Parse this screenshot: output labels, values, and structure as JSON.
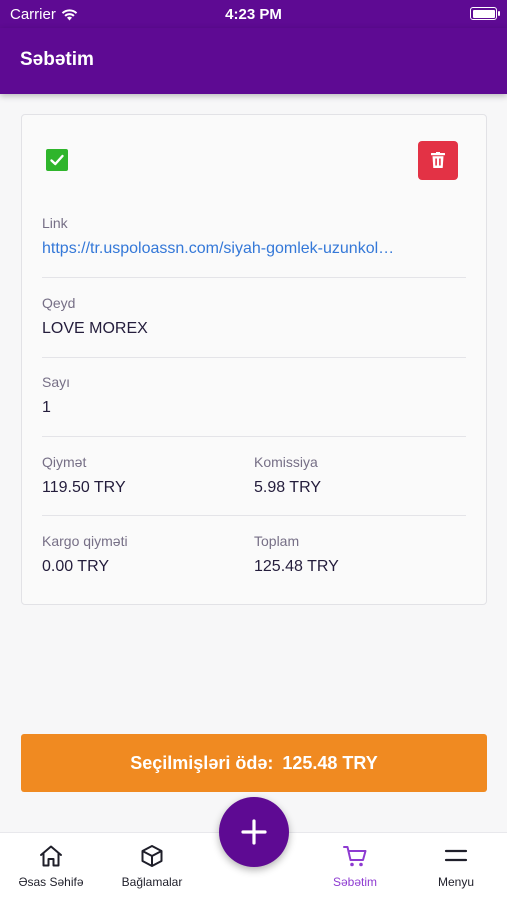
{
  "status_bar": {
    "carrier": "Carrier",
    "time": "4:23 PM"
  },
  "header": {
    "title": "Səbətim"
  },
  "cart_item": {
    "selected": true,
    "link_label": "Link",
    "link_value": "https://tr.uspoloassn.com/siyah-gomlek-uzunkol…",
    "note_label": "Qeyd",
    "note_value": "LOVE MOREX",
    "count_label": "Sayı",
    "count_value": "1",
    "price_label": "Qiymət",
    "price_value": "119.50 TRY",
    "commission_label": "Komissiya",
    "commission_value": "5.98 TRY",
    "cargo_label": "Kargo qiyməti",
    "cargo_value": "0.00 TRY",
    "total_label": "Toplam",
    "total_value": "125.48 TRY"
  },
  "pay_button": {
    "label": "Seçilmişləri ödə:",
    "amount": "125.48 TRY"
  },
  "tabbar": {
    "home": "Əsas Səhifə",
    "packages": "Bağlamalar",
    "cart": "Səbətim",
    "menu": "Menyu"
  },
  "colors": {
    "primary": "#5e0a93",
    "accent": "#f08a21",
    "danger": "#e33245",
    "success": "#2fb52c",
    "link": "#3478d8",
    "active_tab": "#8e3bd1"
  },
  "icons": [
    "wifi-icon",
    "battery-icon",
    "checkbox-checked-icon",
    "trash-icon",
    "home-icon",
    "box-icon",
    "cart-icon",
    "menu-icon",
    "plus-icon"
  ]
}
